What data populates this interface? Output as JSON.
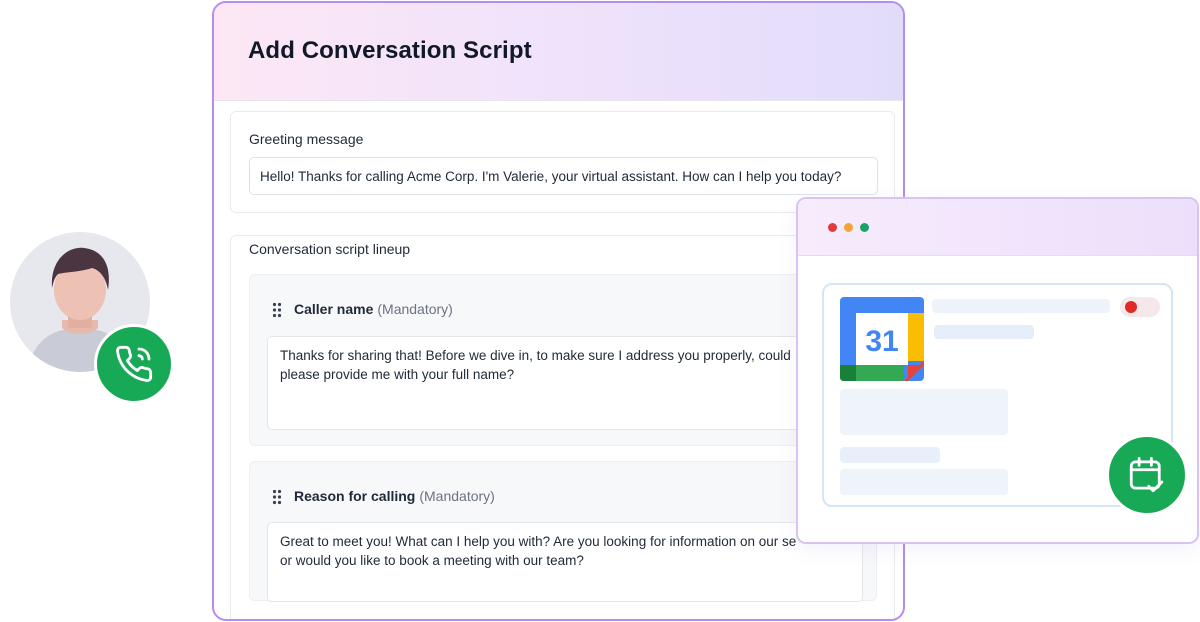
{
  "script": {
    "title": "Add Conversation Script",
    "greeting": {
      "label": "Greeting message",
      "value": "Hello! Thanks for calling Acme Corp. I'm Valerie, your virtual assistant. How can I help you today?"
    },
    "lineup": {
      "label": "Conversation script lineup",
      "steps": [
        {
          "name": "Caller name",
          "tag": "(Mandatory)",
          "text": "Thanks for sharing that! Before we dive in, to make sure I address you properly, could\nplease provide me with your full name?"
        },
        {
          "name": "Reason for calling",
          "tag": "(Mandatory)",
          "text": "Great to meet you! What can I help you with? Are you looking for information on our se\nor would you like to book a meeting with our team?"
        }
      ]
    }
  },
  "calendar": {
    "day_number": "31",
    "colors": {
      "blue": "#4285F4",
      "green": "#34A853",
      "yellow": "#FBBC04",
      "red": "#EA4335",
      "toggle_red": "#E02A2A"
    }
  },
  "icons": {
    "phone": "phone-call-icon",
    "calendar_check": "calendar-check-icon",
    "drag": "drag-handle-icon"
  },
  "colors": {
    "accent_green": "#18A957",
    "card_border": "#B58CF0",
    "header_gradient_start": "#FDE7F4",
    "header_gradient_end": "#E2DCFB"
  }
}
